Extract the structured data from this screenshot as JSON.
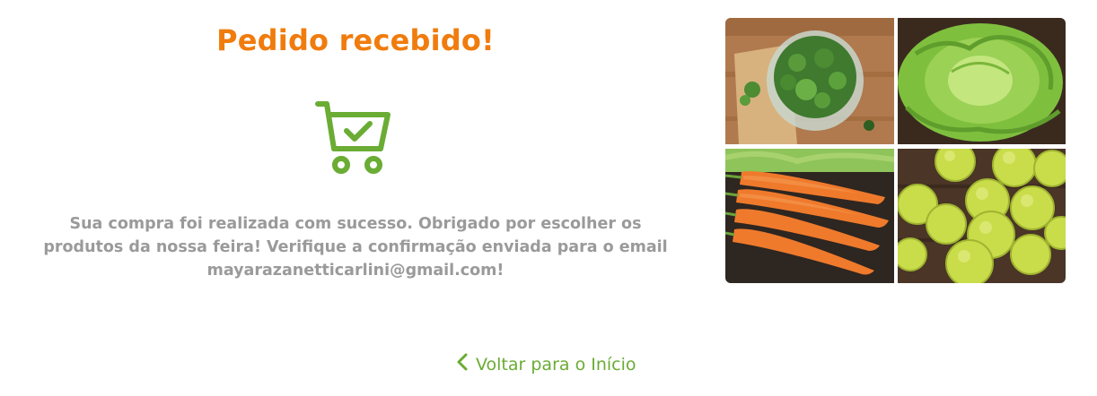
{
  "confirmation": {
    "title": "Pedido recebido!",
    "message": "Sua compra foi realizada com sucesso. Obrigado por escolher os produtos da nossa feira! Verifique a confirmação enviada para o email mayarazanetticarlini@gmail.com!",
    "icon": "cart-check-icon"
  },
  "images": [
    {
      "name": "watercress-image"
    },
    {
      "name": "lettuce-image"
    },
    {
      "name": "carrots-image"
    },
    {
      "name": "limes-image"
    }
  ],
  "navigation": {
    "back_label": "Voltar para o Início",
    "back_icon": "chevron-left-icon"
  },
  "colors": {
    "title": "#f07c0e",
    "accent": "#6aac34",
    "text": "#9a9a9a"
  }
}
